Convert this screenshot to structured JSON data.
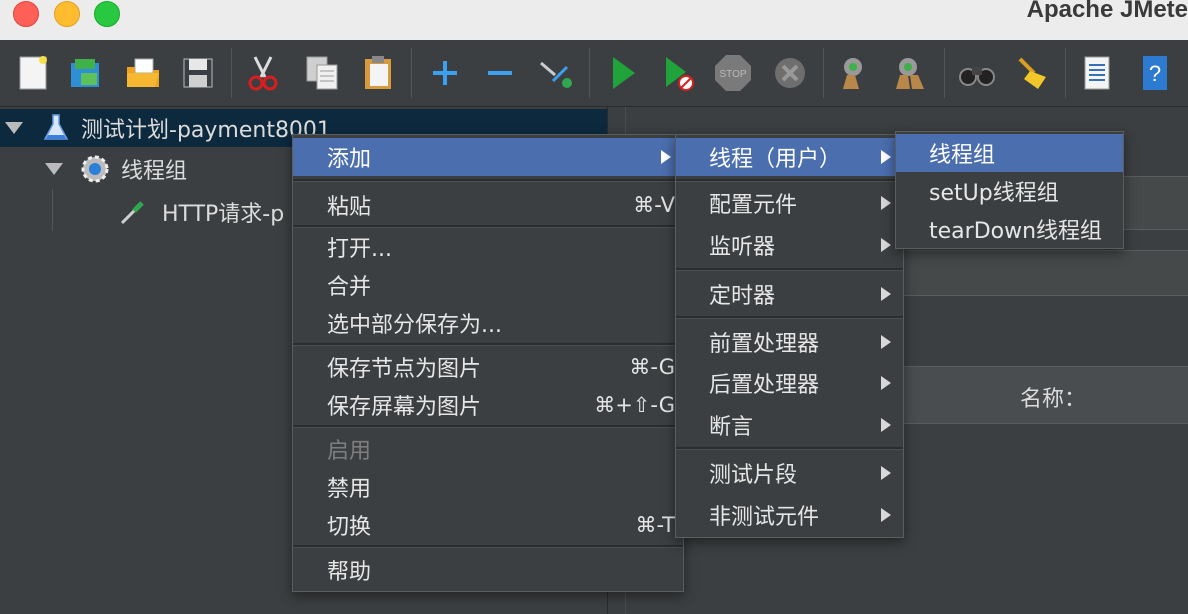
{
  "window": {
    "title": "Apache JMete"
  },
  "toolbar": {
    "icons": [
      "new-icon",
      "templates-icon",
      "open-icon",
      "save-icon",
      "cut-icon",
      "copy-icon",
      "paste-icon",
      "expand-icon",
      "collapse-icon",
      "toggle-icon",
      "start-icon",
      "start-no-pause-icon",
      "stop-icon",
      "shutdown-icon",
      "clear-icon",
      "clear-all-icon",
      "search-icon",
      "reset-search-icon",
      "log-icon",
      "help-icon"
    ]
  },
  "tree": {
    "items": [
      {
        "label": "测试计划-payment8001",
        "icon": "flask-icon"
      },
      {
        "label": "线程组",
        "icon": "gear-icon"
      },
      {
        "label": "HTTP请求-p",
        "icon": "pipette-icon"
      }
    ]
  },
  "right_panel": {
    "name_label": "名称："
  },
  "context_menu": {
    "items": [
      {
        "label": "添加"
      },
      {
        "label": "粘贴",
        "shortcut": "⌘-V"
      },
      {
        "label": "打开..."
      },
      {
        "label": "合并"
      },
      {
        "label": "选中部分保存为..."
      },
      {
        "label": "保存节点为图片",
        "shortcut": "⌘-G"
      },
      {
        "label": "保存屏幕为图片",
        "shortcut": "⌘+⇧-G"
      },
      {
        "label": "启用"
      },
      {
        "label": "禁用"
      },
      {
        "label": "切换",
        "shortcut": "⌘-T"
      },
      {
        "label": "帮助"
      }
    ]
  },
  "add_submenu": {
    "items": [
      {
        "label": "线程（用户）"
      },
      {
        "label": "配置元件"
      },
      {
        "label": "监听器"
      },
      {
        "label": "定时器"
      },
      {
        "label": "前置处理器"
      },
      {
        "label": "后置处理器"
      },
      {
        "label": "断言"
      },
      {
        "label": "测试片段"
      },
      {
        "label": "非测试元件"
      }
    ]
  },
  "threads_submenu": {
    "items": [
      {
        "label": "线程组"
      },
      {
        "label": "setUp线程组"
      },
      {
        "label": "tearDown线程组"
      }
    ]
  },
  "colors": {
    "highlight": "#4b6eaf",
    "background": "#3c3f41",
    "selected_row": "#0d293e"
  }
}
